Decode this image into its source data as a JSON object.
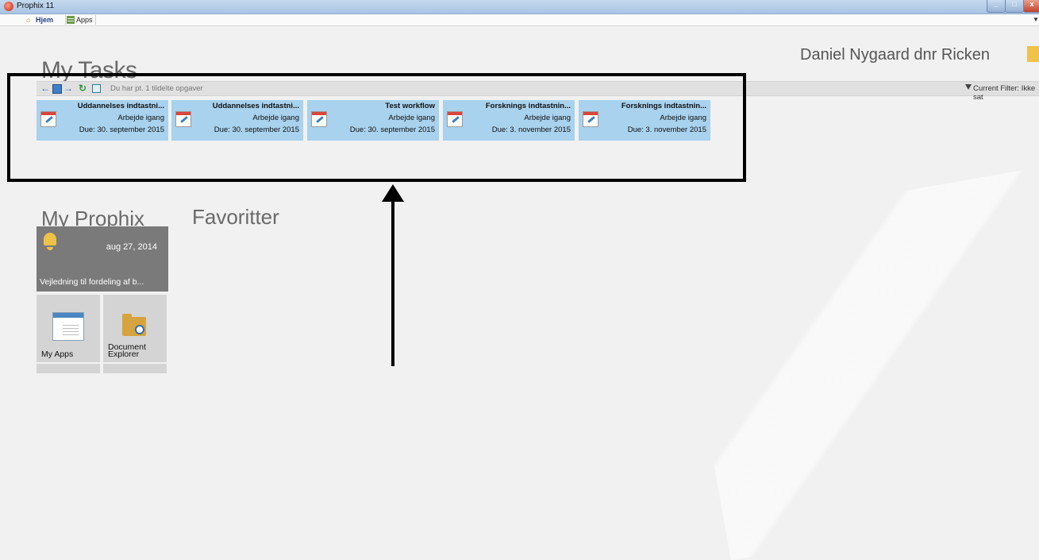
{
  "window": {
    "title": "Prophix 11"
  },
  "tabs": [
    {
      "label": "Hjem",
      "active": true
    },
    {
      "label": "Apps",
      "active": false
    }
  ],
  "user": {
    "name": "Daniel Nygaard dnr Ricken"
  },
  "tasks_section": {
    "title": "My Tasks",
    "status": "Du har pt. 1 tildelte opgaver",
    "filter": "Current Filter: Ikke sat",
    "cards": [
      {
        "title": "Uddannelses indtastni...",
        "status": "Arbejde igang",
        "due": "Due: 30. september 2015"
      },
      {
        "title": "Uddannelses indtastni...",
        "status": "Arbejde igang",
        "due": "Due: 30. september 2015"
      },
      {
        "title": "Test workflow",
        "status": "Arbejde igang",
        "due": "Due: 30. september 2015"
      },
      {
        "title": "Forsknings indtastnin...",
        "status": "Arbejde igang",
        "due": "Due: 3. november 2015"
      },
      {
        "title": "Forsknings indtastnin...",
        "status": "Arbejde igang",
        "due": "Due: 3. november 2015"
      }
    ]
  },
  "my_prophix": {
    "title": "My Prophix",
    "notification": {
      "date": "aug 27, 2014",
      "text": "Vejledning til fordeling af b...",
      "icon": "bell-icon"
    },
    "tiles": [
      {
        "label": "My Apps",
        "icon": "app-window-icon"
      },
      {
        "label": "Document Explorer",
        "icon": "folder-search-icon"
      }
    ]
  },
  "favorites": {
    "title": "Favoritter"
  },
  "colors": {
    "task_card": "#a8d2ee",
    "notification_tile": "#7a7a7a",
    "app_tile": "#d4d4d4"
  }
}
